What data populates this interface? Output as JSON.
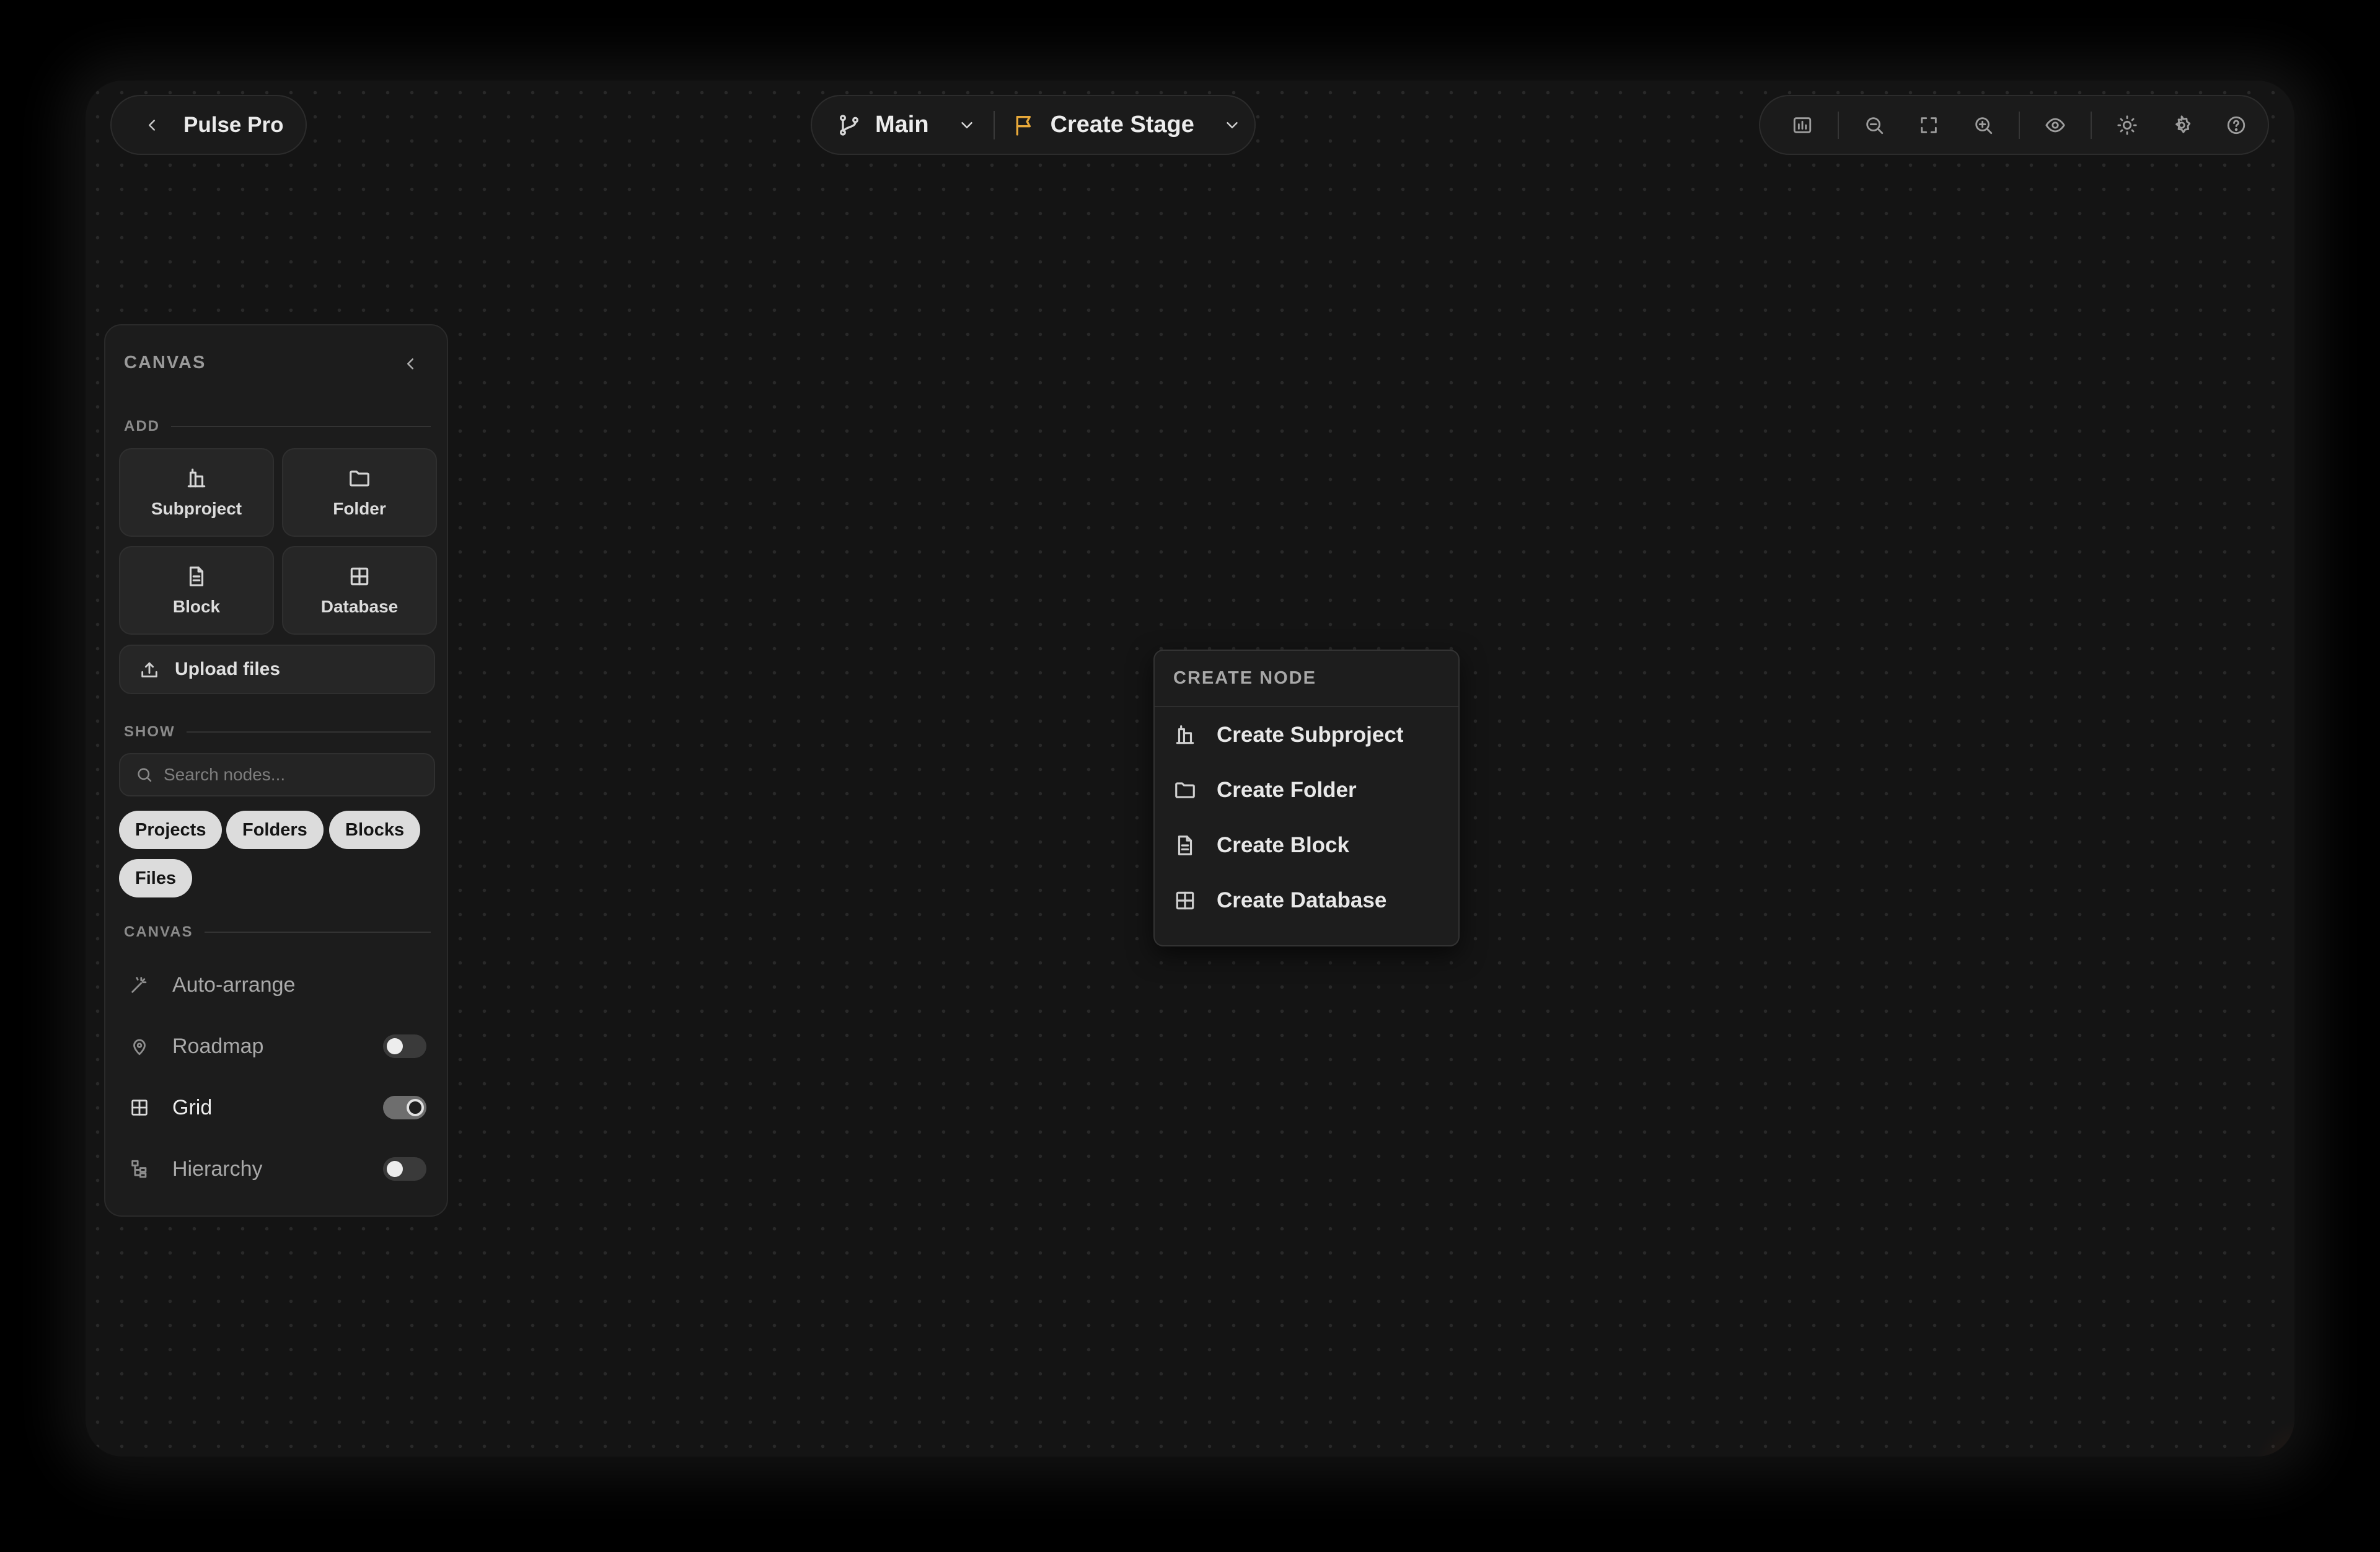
{
  "project": {
    "name": "Pulse Pro"
  },
  "branch": {
    "name": "Main"
  },
  "stage": {
    "name": "Create Stage",
    "flag_color": "#e8a93a"
  },
  "toolbar": {
    "tools": [
      "chart-icon",
      "zoom-out-icon",
      "fit-screen-icon",
      "zoom-in-icon",
      "eye-icon",
      "sun-icon",
      "settings-icon",
      "help-icon"
    ]
  },
  "panel": {
    "title": "CANVAS",
    "add_section": "ADD",
    "add_items": [
      {
        "label": "Subproject",
        "icon": "subproject-icon"
      },
      {
        "label": "Folder",
        "icon": "folder-icon"
      },
      {
        "label": "Block",
        "icon": "document-icon"
      },
      {
        "label": "Database",
        "icon": "table-icon"
      }
    ],
    "upload_label": "Upload files",
    "show_section": "SHOW",
    "search_placeholder": "Search nodes...",
    "filters": [
      "Projects",
      "Folders",
      "Blocks",
      "Files"
    ],
    "canvas_section": "CANVAS",
    "canvas_options": [
      {
        "label": "Auto-arrange",
        "icon": "wand-icon"
      },
      {
        "label": "Roadmap",
        "icon": "roadmap-icon",
        "toggle": false
      },
      {
        "label": "Grid",
        "icon": "grid-icon",
        "toggle": true
      },
      {
        "label": "Hierarchy",
        "icon": "hierarchy-icon",
        "toggle": false
      }
    ]
  },
  "context_menu": {
    "title": "CREATE NODE",
    "items": [
      {
        "label": "Create Subproject",
        "icon": "subproject-icon"
      },
      {
        "label": "Create Folder",
        "icon": "folder-icon"
      },
      {
        "label": "Create Block",
        "icon": "document-icon"
      },
      {
        "label": "Create Database",
        "icon": "table-icon"
      }
    ]
  }
}
